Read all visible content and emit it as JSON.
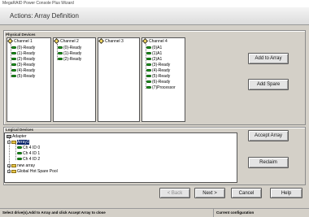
{
  "window": {
    "title": "MegaRAID Power Console Plus Wizard",
    "caption": "Actions: Array Definition"
  },
  "physical_devices": {
    "label": "Physical Devices",
    "channels": [
      {
        "label": "Channel 1",
        "drives": [
          "(0)-Ready",
          "(1)-Ready",
          "(2)-Ready",
          "(3)-Ready",
          "(4)-Ready",
          "(5)-Ready"
        ]
      },
      {
        "label": "Channel 2",
        "drives": [
          "(0)-Ready",
          "(1)-Ready",
          "(2)-Ready"
        ]
      },
      {
        "label": "Channel 3",
        "drives": []
      },
      {
        "label": "Channel 4",
        "drives": [
          "(0)A1",
          "(1)A1",
          "(2)A1",
          "(3)-Ready",
          "(4)-Ready",
          "(5)-Ready",
          "(6)-Ready",
          "(7)Processor"
        ]
      }
    ]
  },
  "logical_devices": {
    "label": "Logical Devices",
    "tree": {
      "root": "Adapter",
      "array": "Array1",
      "children": [
        "Ch 4 ID 0",
        "Ch 4 ID 1",
        "Ch 4 ID 2"
      ],
      "new_array": "new array",
      "spare_pool": "Global Hot Spare Pool"
    }
  },
  "buttons": {
    "add_to_array": "Add to Array",
    "add_spare": "Add Spare",
    "accept_array": "Accept Array",
    "reclaim": "Reclaim",
    "back": "< Back",
    "next": "Next >",
    "cancel": "Cancel",
    "help": "Help"
  },
  "status": {
    "left": "Select drive(s).Add to Array and click Accept Array to close",
    "right": "Current configuration"
  }
}
